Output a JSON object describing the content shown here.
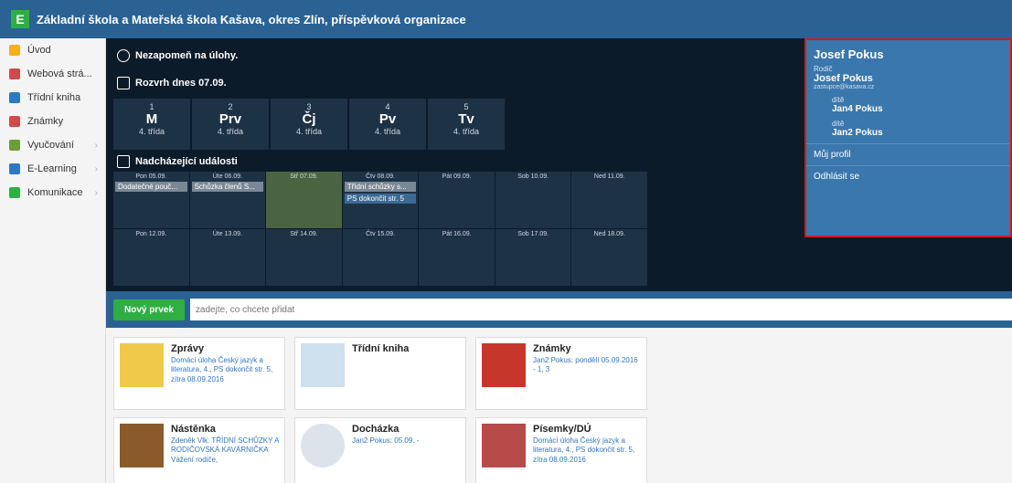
{
  "header": {
    "school": "Základní škola a Mateřská škola Kašava, okres Zlín, příspěvková organizace"
  },
  "sidebar": {
    "items": [
      "Úvod",
      "Webová strá...",
      "Třídní kniha",
      "Známky",
      "Vyučování",
      "E-Learning",
      "Komunikace"
    ]
  },
  "dashboard": {
    "reminder": "Nezapomeň na úlohy.",
    "timetable_title": "Rozvrh dnes 07.09.",
    "events_title": "Nadcházející události"
  },
  "timetable": [
    {
      "num": "1",
      "subj": "M",
      "cls": "4. třída"
    },
    {
      "num": "2",
      "subj": "Prv",
      "cls": "4. třída"
    },
    {
      "num": "3",
      "subj": "Čj",
      "cls": "4. třída"
    },
    {
      "num": "4",
      "subj": "Pv",
      "cls": "4. třída"
    },
    {
      "num": "5",
      "subj": "Tv",
      "cls": "4. třída"
    }
  ],
  "calendar": {
    "w1": [
      {
        "d": "Pon 05.09.",
        "e": "Dodatečné pouč..."
      },
      {
        "d": "Úte 06.09.",
        "e": "Schůzka členů S..."
      },
      {
        "d": "Stř 07.09."
      },
      {
        "d": "Čtv 08.09.",
        "e": "Třídní schůzky s...",
        "e2": "PS dokončit str. 5"
      },
      {
        "d": "Pát 09.09."
      },
      {
        "d": "Sob 10.09."
      },
      {
        "d": "Ned 11.09."
      }
    ],
    "w2": [
      "Pon 12.09.",
      "Úte 13.09.",
      "Stř 14.09.",
      "Čtv 15.09.",
      "Pát 16.09.",
      "Sob 17.09.",
      "Ned 18.09."
    ]
  },
  "newbar": {
    "button": "Nový prvek",
    "placeholder": "zadejte, co chcete přidat"
  },
  "tiles": [
    {
      "title": "Zprávy",
      "sub": "Domácí úloha Český jazyk a literatura, 4., PS dokončit str. 5, zítra 08.09.2016"
    },
    {
      "title": "Třídní kniha",
      "sub": ""
    },
    {
      "title": "Známky",
      "sub": "Jan2 Pokus: pondělí 05.09.2016 - 1, 3"
    },
    {
      "title": "Nástěnka",
      "sub": "Zdeněk Vlk: TŘÍDNÍ SCHŮZKY A RODIČOVSKÁ KAVÁRNIČKA Vážení rodiče,"
    },
    {
      "title": "Docházka",
      "sub": "Jan2 Pokus: 05.09. -"
    },
    {
      "title": "Písemky/DÚ",
      "sub": "Domácí úloha Český jazyk a literatura, 4., PS dokončit str. 5, zítra 08.09.2016"
    }
  ],
  "panel": {
    "name": "Josef Pokus",
    "role": "Rodič",
    "email": "zastupce@kasava.cz",
    "child_label": "dítě",
    "children": [
      "Jan4 Pokus",
      "Jan2 Pokus"
    ],
    "profile": "Můj profil",
    "logout": "Odhlásit se"
  }
}
